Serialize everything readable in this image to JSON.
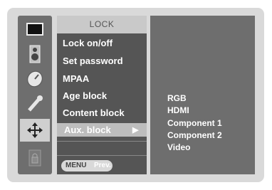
{
  "menu": {
    "title": "LOCK",
    "items": [
      "Lock on/off",
      "Set password",
      "MPAA",
      "Age block",
      "Content block"
    ],
    "selected": {
      "label": "Aux. block",
      "arrow": "▶"
    },
    "footer": {
      "menu_label": "MENU",
      "prev_label": "Prev."
    }
  },
  "submenu": {
    "items": [
      "RGB",
      "HDMI",
      "Component 1",
      "Component 2",
      "Video"
    ]
  },
  "icons": [
    "picture-icon",
    "speaker-icon",
    "clock-icon",
    "wrench-icon",
    "cross-arrows-icon",
    "lock-icon"
  ]
}
